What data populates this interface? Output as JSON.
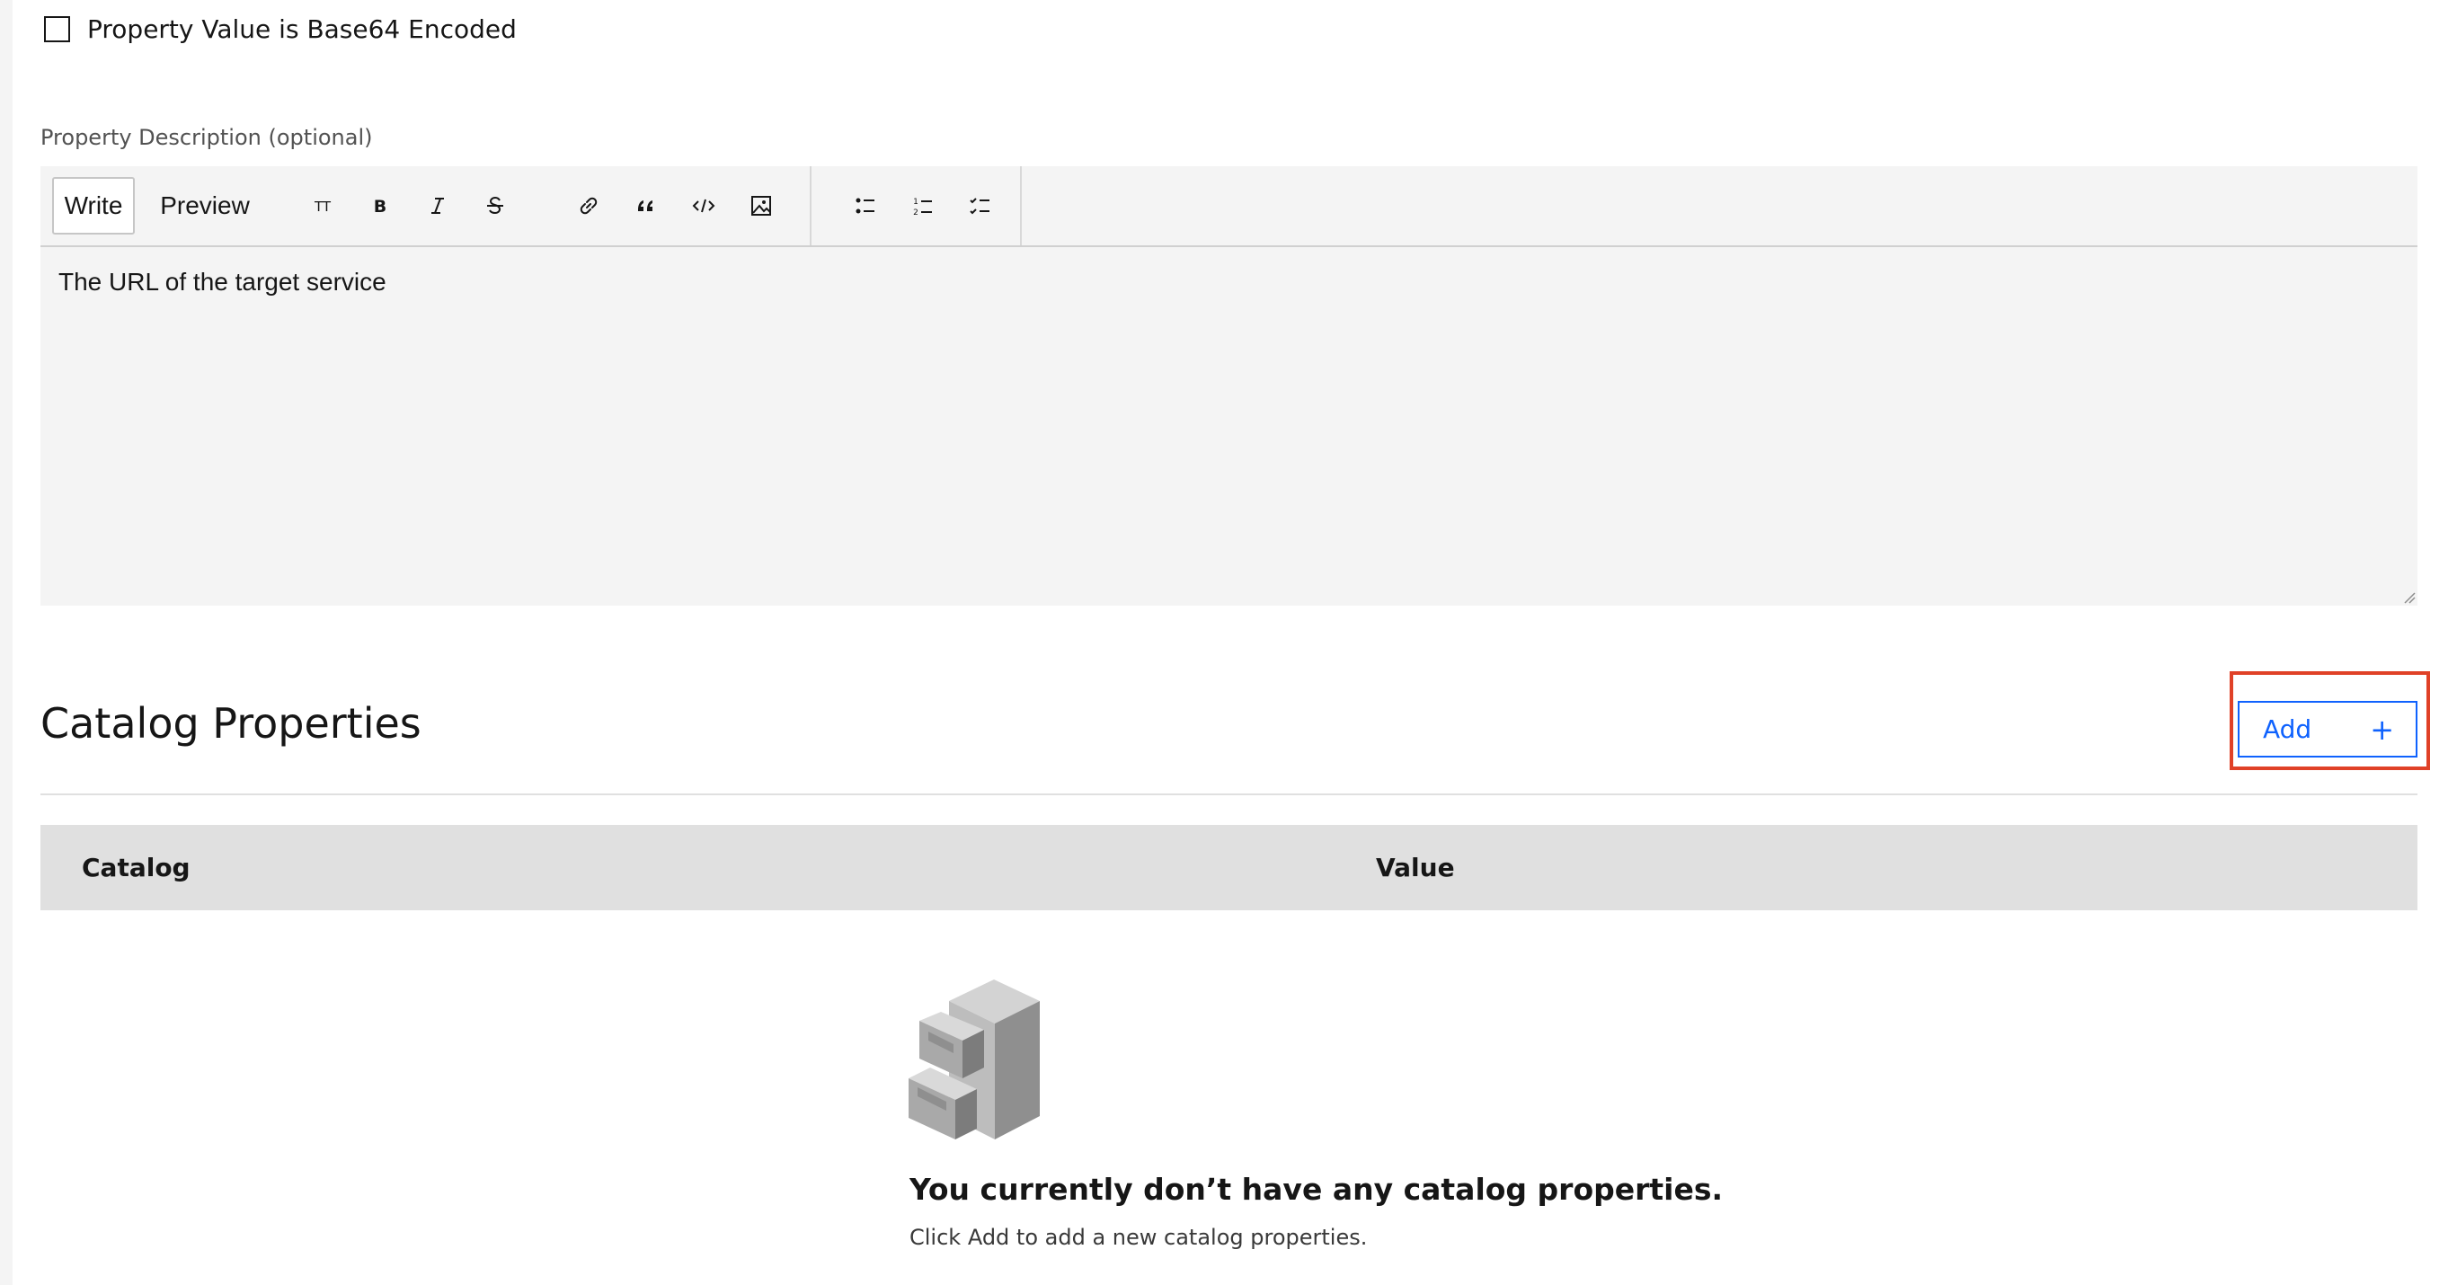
{
  "checkbox": {
    "label": "Property Value is Base64 Encoded",
    "checked": false
  },
  "description": {
    "label": "Property Description (optional)",
    "tabs": {
      "write": "Write",
      "preview": "Preview"
    },
    "toolbar_icons": [
      "heading-icon",
      "bold-icon",
      "italic-icon",
      "strikethrough-icon",
      "link-icon",
      "quote-icon",
      "code-icon",
      "image-icon",
      "bulleted-list-icon",
      "numbered-list-icon",
      "task-list-icon"
    ],
    "text": "The URL of the target service"
  },
  "catalog": {
    "title": "Catalog Properties",
    "add_label": "Add",
    "add_icon": "+",
    "columns": {
      "catalog": "Catalog",
      "value": "Value"
    },
    "empty_title": "You currently don’t have any catalog properties.",
    "empty_subtitle": "Click Add to add a new catalog properties."
  },
  "colors": {
    "accent": "#0f62fe",
    "highlight": "#e04127"
  }
}
